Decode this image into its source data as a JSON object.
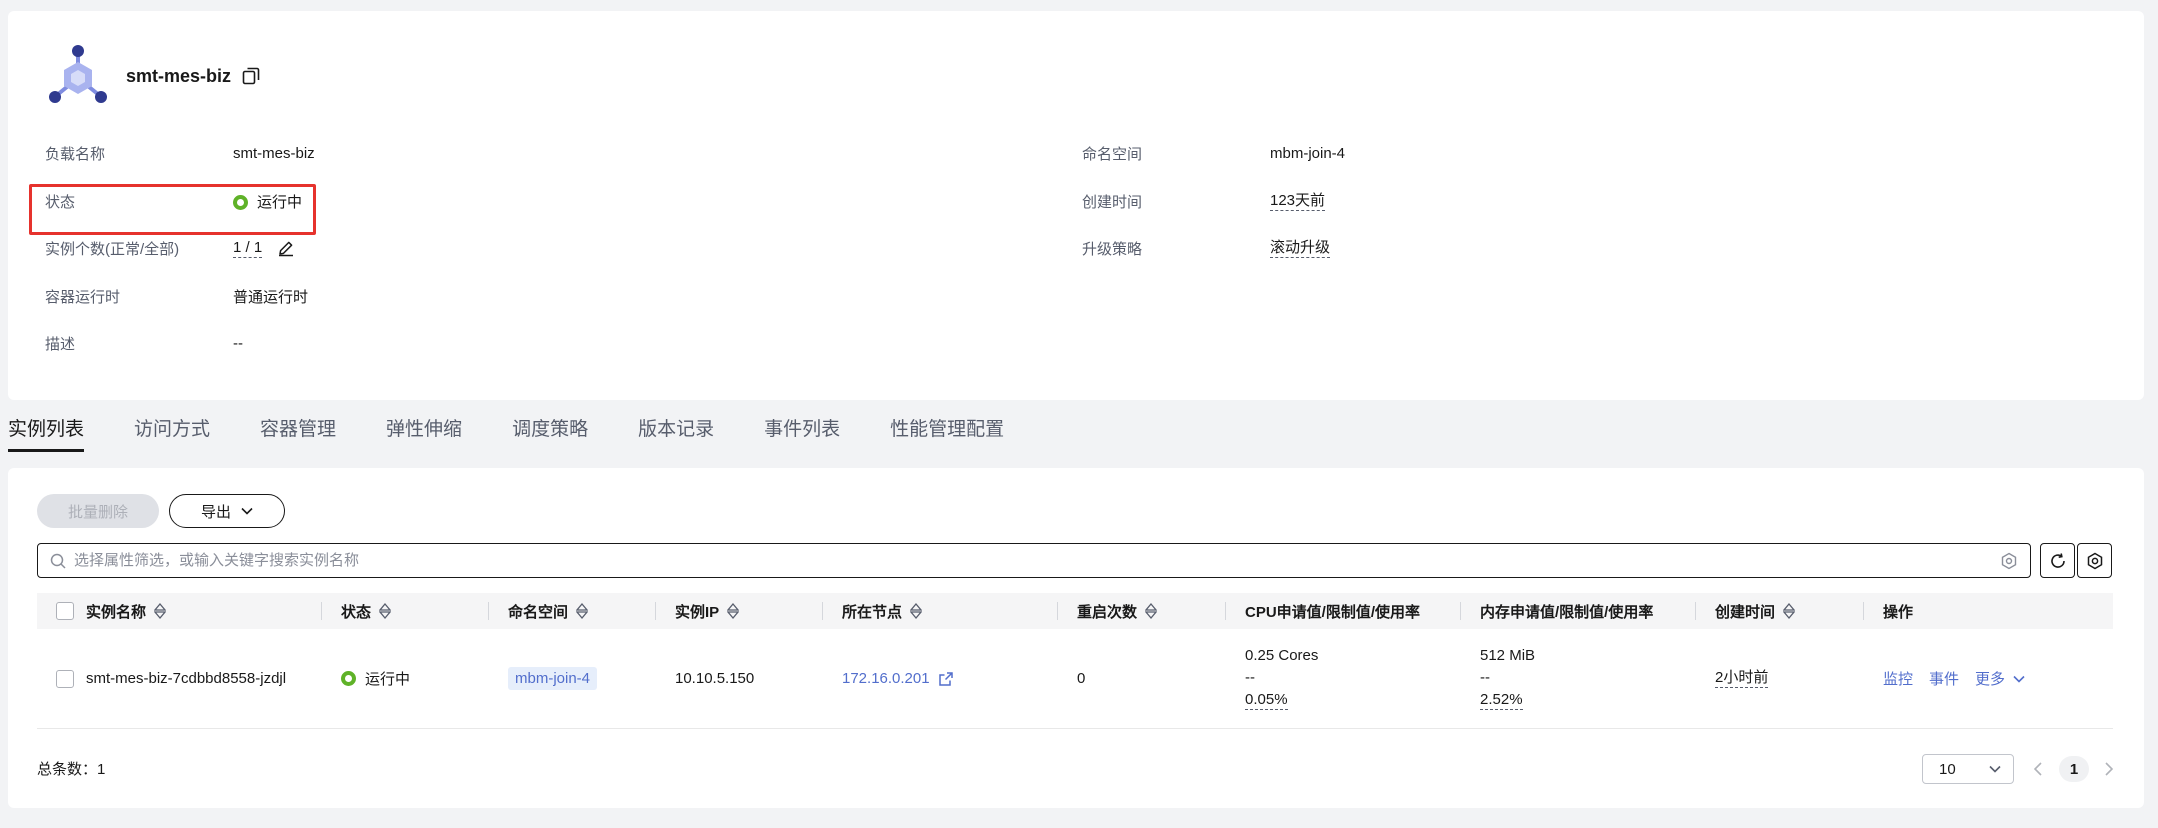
{
  "workload": {
    "name": "smt-mes-biz",
    "icon": "workload-logo-icon"
  },
  "info": {
    "name_label": "负载名称",
    "name_value": "smt-mes-biz",
    "status_label": "状态",
    "status_value": "运行中",
    "instances_label": "实例个数(正常/全部)",
    "instances_value": "1 / 1",
    "runtime_label": "容器运行时",
    "runtime_value": "普通运行时",
    "desc_label": "描述",
    "desc_value": "--",
    "namespace_label": "命名空间",
    "namespace_value": "mbm-join-4",
    "created_label": "创建时间",
    "created_value": "123天前",
    "upgrade_label": "升级策略",
    "upgrade_value": "滚动升级"
  },
  "tabs": [
    "实例列表",
    "访问方式",
    "容器管理",
    "弹性伸缩",
    "调度策略",
    "版本记录",
    "事件列表",
    "性能管理配置"
  ],
  "toolbar": {
    "batch_delete": "批量删除",
    "export": "导出",
    "search_placeholder": "选择属性筛选，或输入关键字搜索实例名称"
  },
  "table": {
    "headers": [
      "实例名称",
      "状态",
      "命名空间",
      "实例IP",
      "所在节点",
      "重启次数",
      "CPU申请值/限制值/使用率",
      "内存申请值/限制值/使用率",
      "创建时间",
      "操作"
    ],
    "rows": [
      {
        "name": "smt-mes-biz-7cdbbd8558-jzdjl",
        "status": "运行中",
        "namespace": "mbm-join-4",
        "ip": "10.10.5.150",
        "node": "172.16.0.201",
        "restarts": "0",
        "cpu_request": "0.25 Cores",
        "cpu_limit": "--",
        "cpu_usage": "0.05%",
        "mem_request": "512 MiB",
        "mem_limit": "--",
        "mem_usage": "2.52%",
        "created": "2小时前",
        "op_monitor": "监控",
        "op_event": "事件",
        "op_more": "更多"
      }
    ]
  },
  "footer": {
    "total": "总条数：1",
    "page_size": "10",
    "current_page": "1"
  },
  "colors": {
    "running": "#5fb228",
    "link": "#526ecc",
    "highlight": "#e6322d"
  }
}
